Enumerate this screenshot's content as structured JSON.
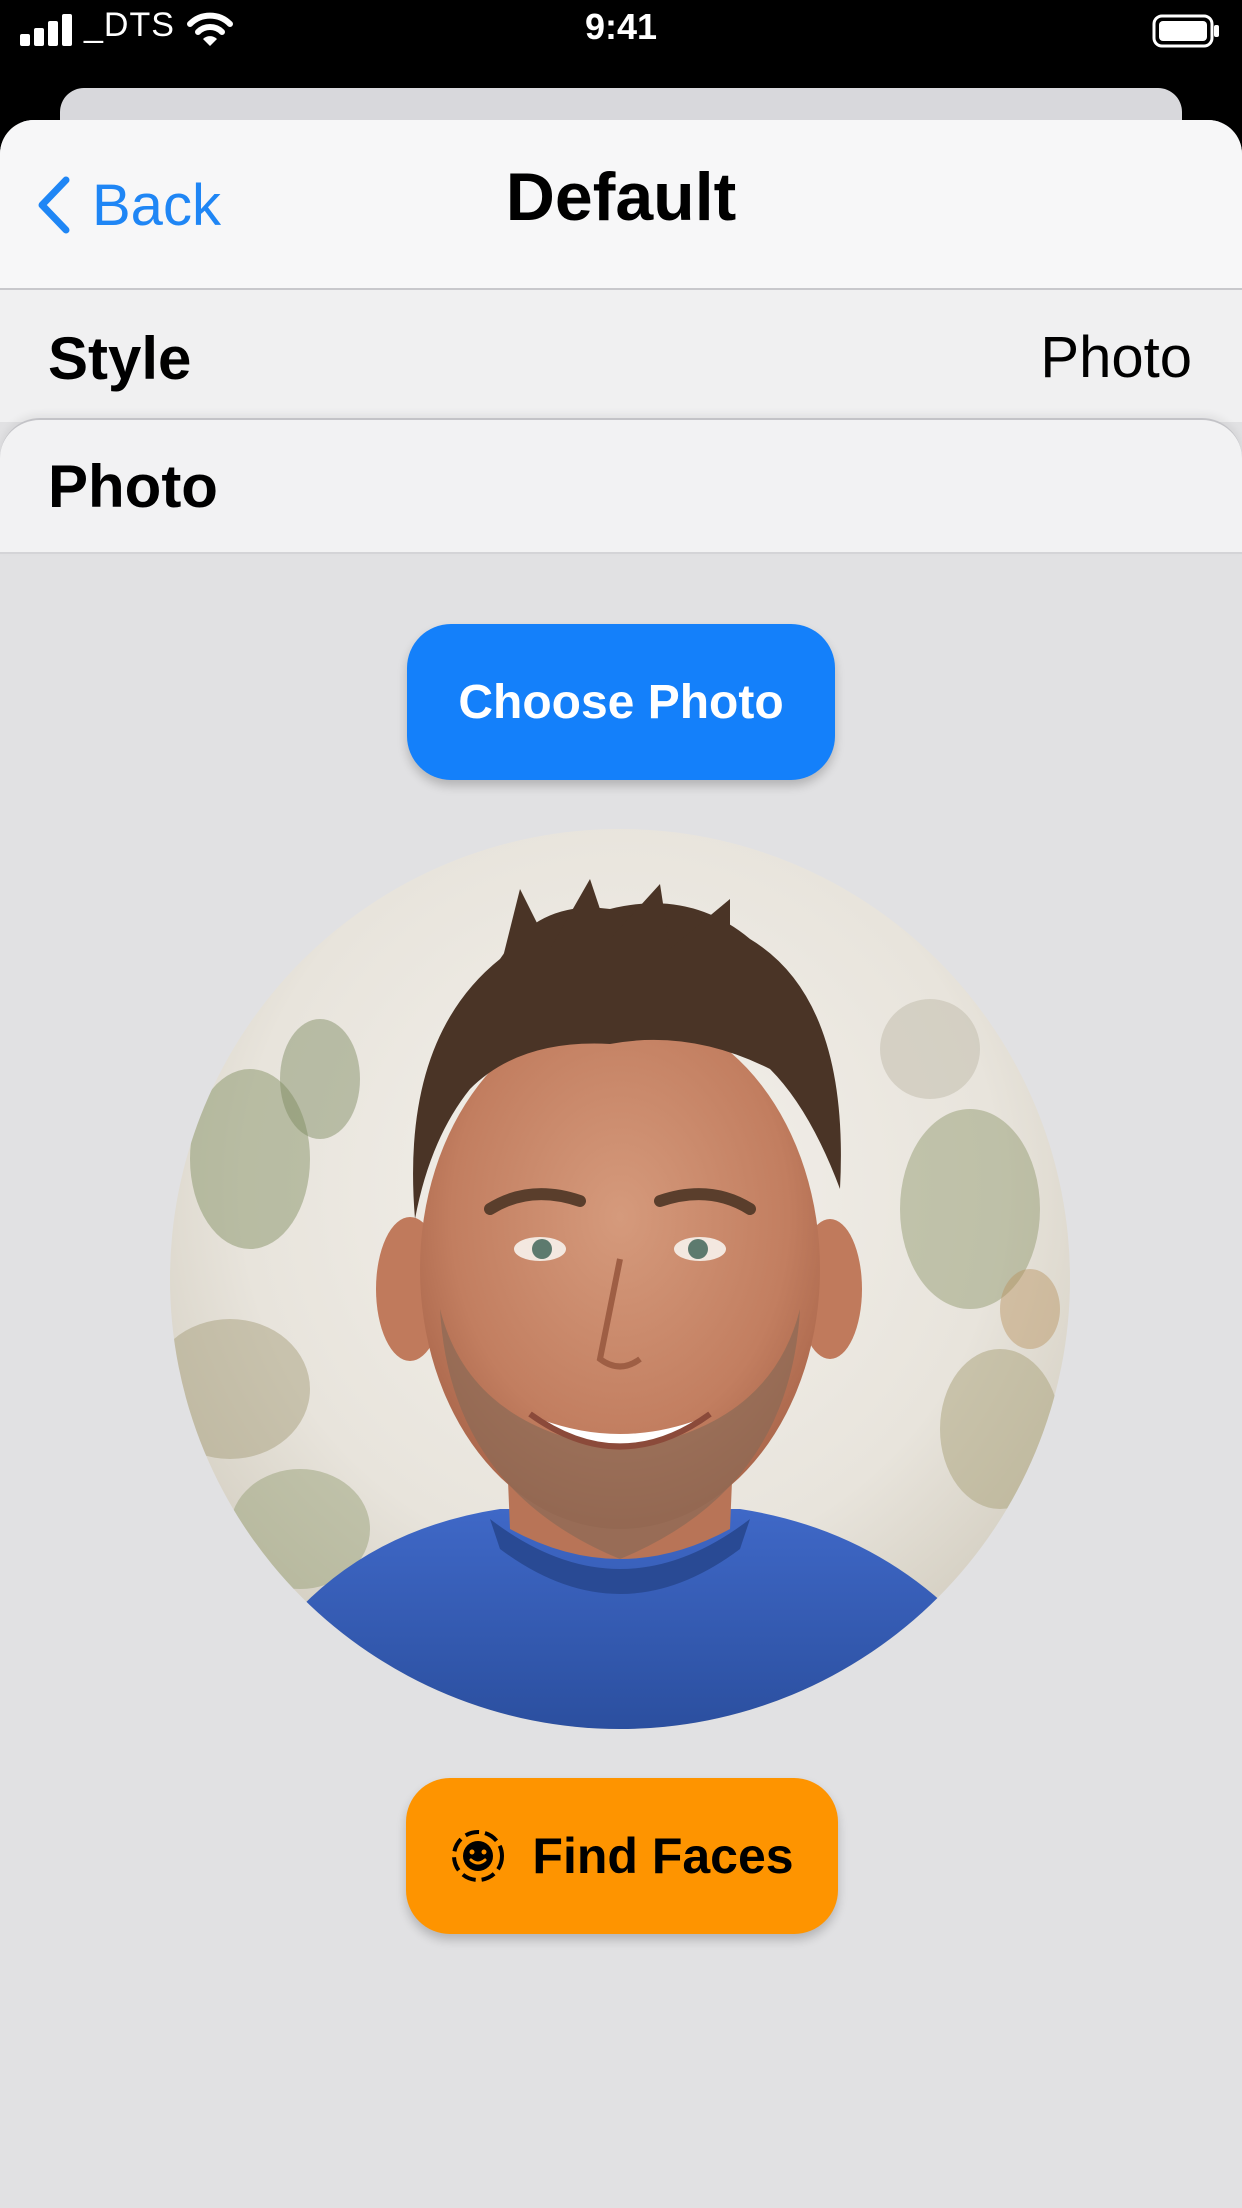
{
  "status_bar": {
    "carrier": "_DTS",
    "time": "9:41",
    "signal_icon": "signal-bars-icon",
    "wifi_icon": "wifi-icon",
    "battery_icon": "battery-icon"
  },
  "nav": {
    "back_label": "Back",
    "back_icon": "chevron-left-icon",
    "title": "Default"
  },
  "style_row": {
    "label": "Style",
    "value": "Photo"
  },
  "photo_section": {
    "label": "Photo"
  },
  "buttons": {
    "choose_photo": "Choose Photo",
    "find_faces": "Find Faces",
    "find_faces_icon": "face-detect-icon"
  },
  "colors": {
    "accent_blue": "#1480fa",
    "accent_orange": "#fe9400",
    "link_blue": "#1f86f5",
    "background": "#e1e1e3"
  }
}
